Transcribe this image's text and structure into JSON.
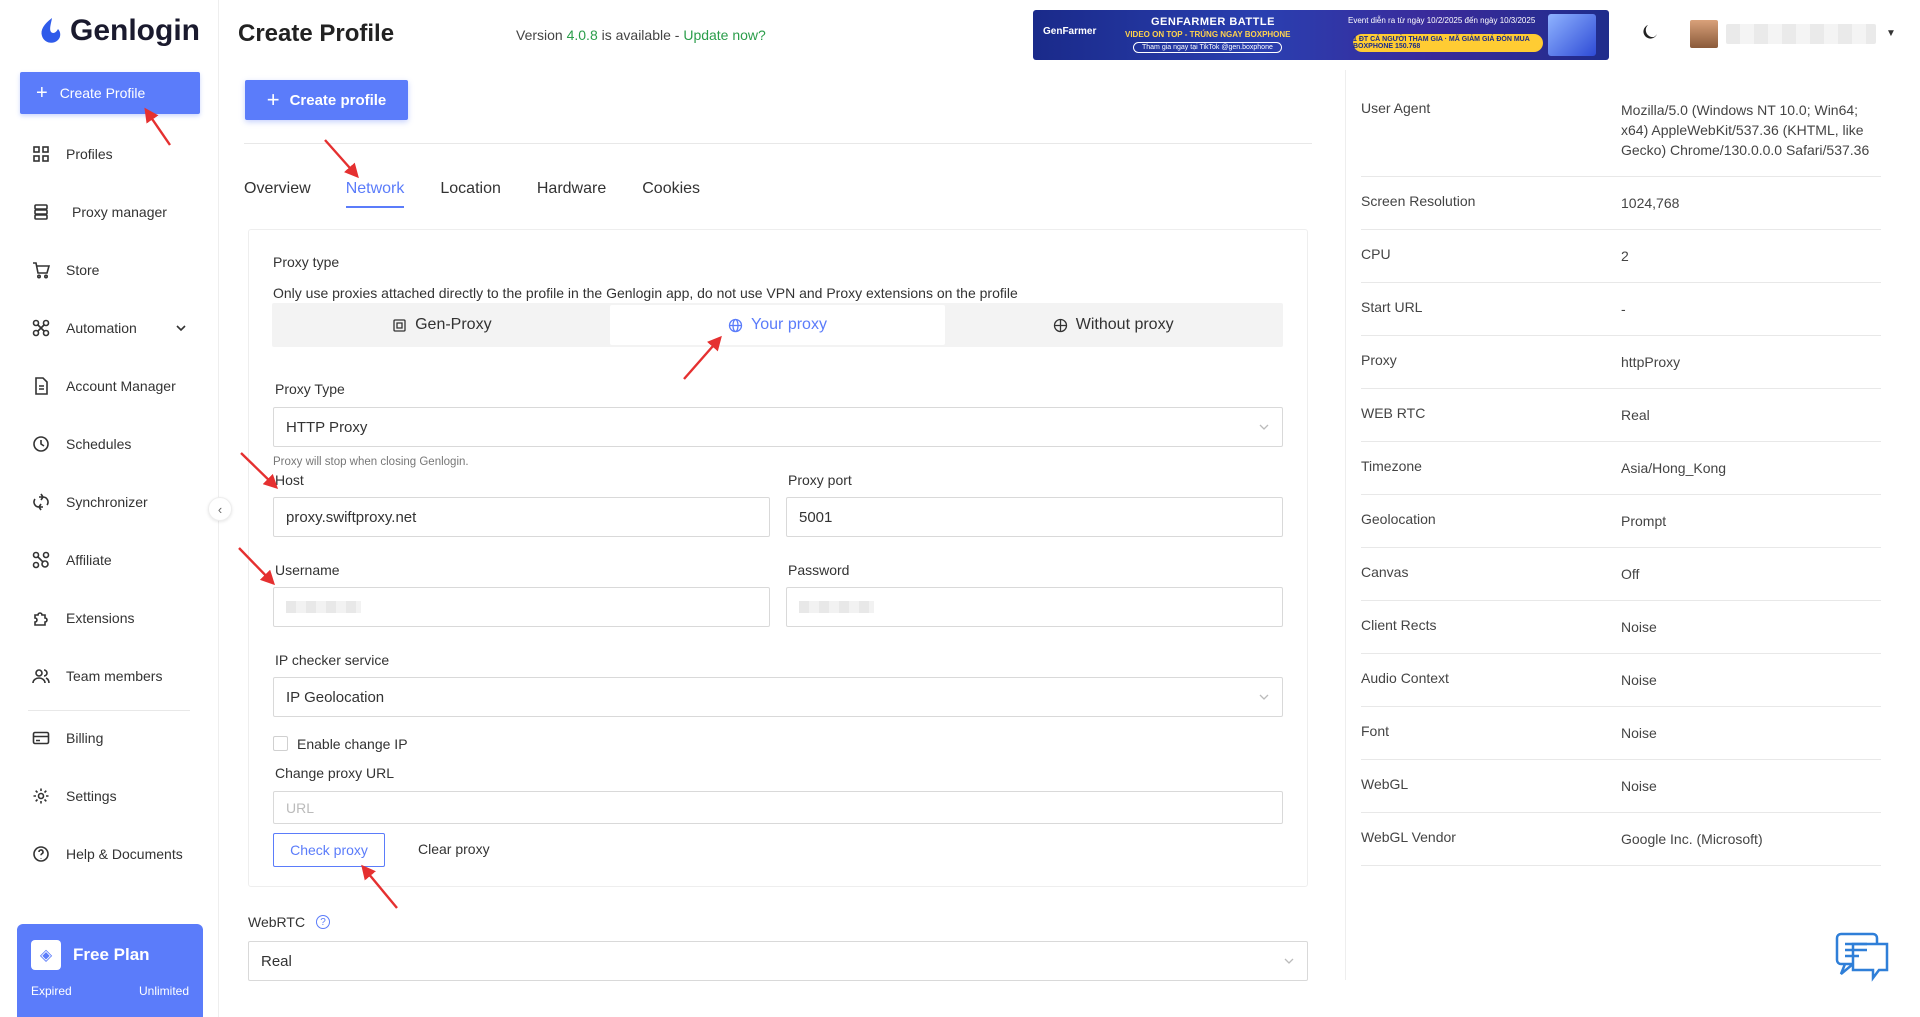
{
  "app": {
    "name": "Genlogin"
  },
  "sidebar": {
    "create_label": "Create Profile",
    "items": [
      {
        "label": "Profiles",
        "icon": "grid-icon"
      },
      {
        "label": "Proxy manager",
        "icon": "server-icon"
      },
      {
        "label": "Store",
        "icon": "cart-icon"
      },
      {
        "label": "Automation",
        "icon": "automation-icon"
      },
      {
        "label": "Account Manager",
        "icon": "document-icon"
      },
      {
        "label": "Schedules",
        "icon": "clock-icon"
      },
      {
        "label": "Synchronizer",
        "icon": "sync-icon"
      },
      {
        "label": "Affiliate",
        "icon": "affiliate-icon"
      },
      {
        "label": "Extensions",
        "icon": "puzzle-icon"
      },
      {
        "label": "Team members",
        "icon": "team-icon"
      },
      {
        "label": "Billing",
        "icon": "card-icon"
      },
      {
        "label": "Settings",
        "icon": "gear-icon"
      },
      {
        "label": "Help & Documents",
        "icon": "help-icon"
      }
    ],
    "plan": {
      "title": "Free Plan",
      "status": "Expired",
      "quota": "Unlimited"
    }
  },
  "header": {
    "title": "Create Profile",
    "version_prefix": "Version ",
    "version": "4.0.8",
    "version_mid": " is available - ",
    "update_link": "Update now?",
    "banner": {
      "brand": "GenFarmer",
      "title": "GENFARMER BATTLE",
      "subtitle": "VIDEO ON TOP - TRÚNG NGAY BOXPHONE",
      "pill": "Tham gia ngay tại TikTok @gen.boxphone",
      "event": "Event diễn ra từ ngày 10/2/2025 đến ngày 10/3/2025",
      "cta": "1 ĐT CÁ NGƯỜI THAM GIA · MÃ GIẢM GIÁ ĐÓN MUA BOXPHONE 150.768"
    }
  },
  "main": {
    "create_button": "Create profile",
    "tabs": [
      "Overview",
      "Network",
      "Location",
      "Hardware",
      "Cookies"
    ],
    "active_tab": "Network",
    "proxy_type_heading": "Proxy type",
    "proxy_hint": "Only use proxies attached directly to the profile in the Genlogin app, do not use VPN and Proxy extensions on the profile",
    "proxy_modes": [
      "Gen-Proxy",
      "Your proxy",
      "Without proxy"
    ],
    "active_mode": "Your proxy",
    "proxy_type_label": "Proxy Type",
    "proxy_type_value": "HTTP Proxy",
    "proxy_note": "Proxy will stop when closing Genlogin.",
    "host_label": "Host",
    "host_value": "proxy.swiftproxy.net",
    "port_label": "Proxy port",
    "port_value": "5001",
    "username_label": "Username",
    "password_label": "Password",
    "ip_checker_label": "IP checker service",
    "ip_checker_value": "IP Geolocation",
    "enable_change_ip": "Enable change IP",
    "change_url_label": "Change proxy URL",
    "change_url_placeholder": "URL",
    "check_proxy": "Check proxy",
    "clear_proxy": "Clear proxy",
    "webrtc_label": "WebRTC",
    "webrtc_value": "Real"
  },
  "summary": [
    {
      "k": "User Agent",
      "v": "Mozilla/5.0 (Windows NT 10.0; Win64; x64) AppleWebKit/537.36 (KHTML, like Gecko) Chrome/130.0.0.0 Safari/537.36"
    },
    {
      "k": "Screen Resolution",
      "v": "1024,768"
    },
    {
      "k": "CPU",
      "v": "2"
    },
    {
      "k": "Start URL",
      "v": "-"
    },
    {
      "k": "Proxy",
      "v": "httpProxy"
    },
    {
      "k": "WEB RTC",
      "v": "Real"
    },
    {
      "k": "Timezone",
      "v": "Asia/Hong_Kong"
    },
    {
      "k": "Geolocation",
      "v": "Prompt"
    },
    {
      "k": "Canvas",
      "v": "Off"
    },
    {
      "k": "Client Rects",
      "v": "Noise"
    },
    {
      "k": "Audio Context",
      "v": "Noise"
    },
    {
      "k": "Font",
      "v": "Noise"
    },
    {
      "k": "WebGL",
      "v": "Noise"
    },
    {
      "k": "WebGL Vendor",
      "v": "Google Inc. (Microsoft)"
    }
  ],
  "colors": {
    "accent": "#5b7cfa",
    "update": "#2a9d4a",
    "annotation": "#e53030"
  }
}
